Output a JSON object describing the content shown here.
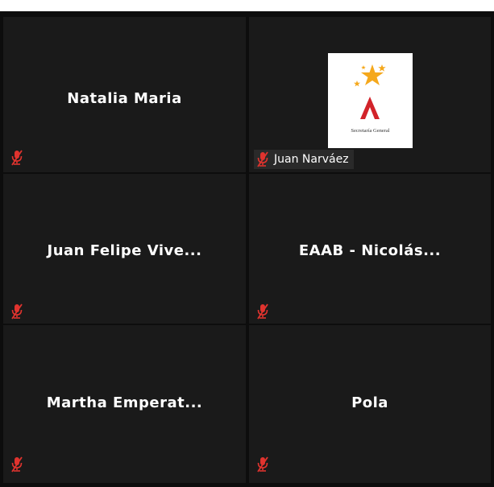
{
  "participants": [
    {
      "display_name": "Natalia Maria",
      "muted": true
    },
    {
      "display_name": "",
      "label": "Juan Narváez",
      "has_avatar": true,
      "avatar_caption": "Secretaría General",
      "muted": true
    },
    {
      "display_name": "Juan  Felipe  Vive...",
      "muted": true
    },
    {
      "display_name": "EAAB  -  Nicolás...",
      "muted": true
    },
    {
      "display_name": "Martha  Emperat...",
      "muted": true
    },
    {
      "display_name": "Pola",
      "muted": true
    }
  ],
  "icons": {
    "muted_mic": "mic-muted-icon",
    "avatar_logo": "secretaria-general-logo"
  },
  "colors": {
    "background": "#0d0d0d",
    "tile": "#1a1a1a",
    "muted_icon": "#e0332e",
    "logo_red": "#d2232a",
    "logo_gold": "#f5a81c"
  }
}
